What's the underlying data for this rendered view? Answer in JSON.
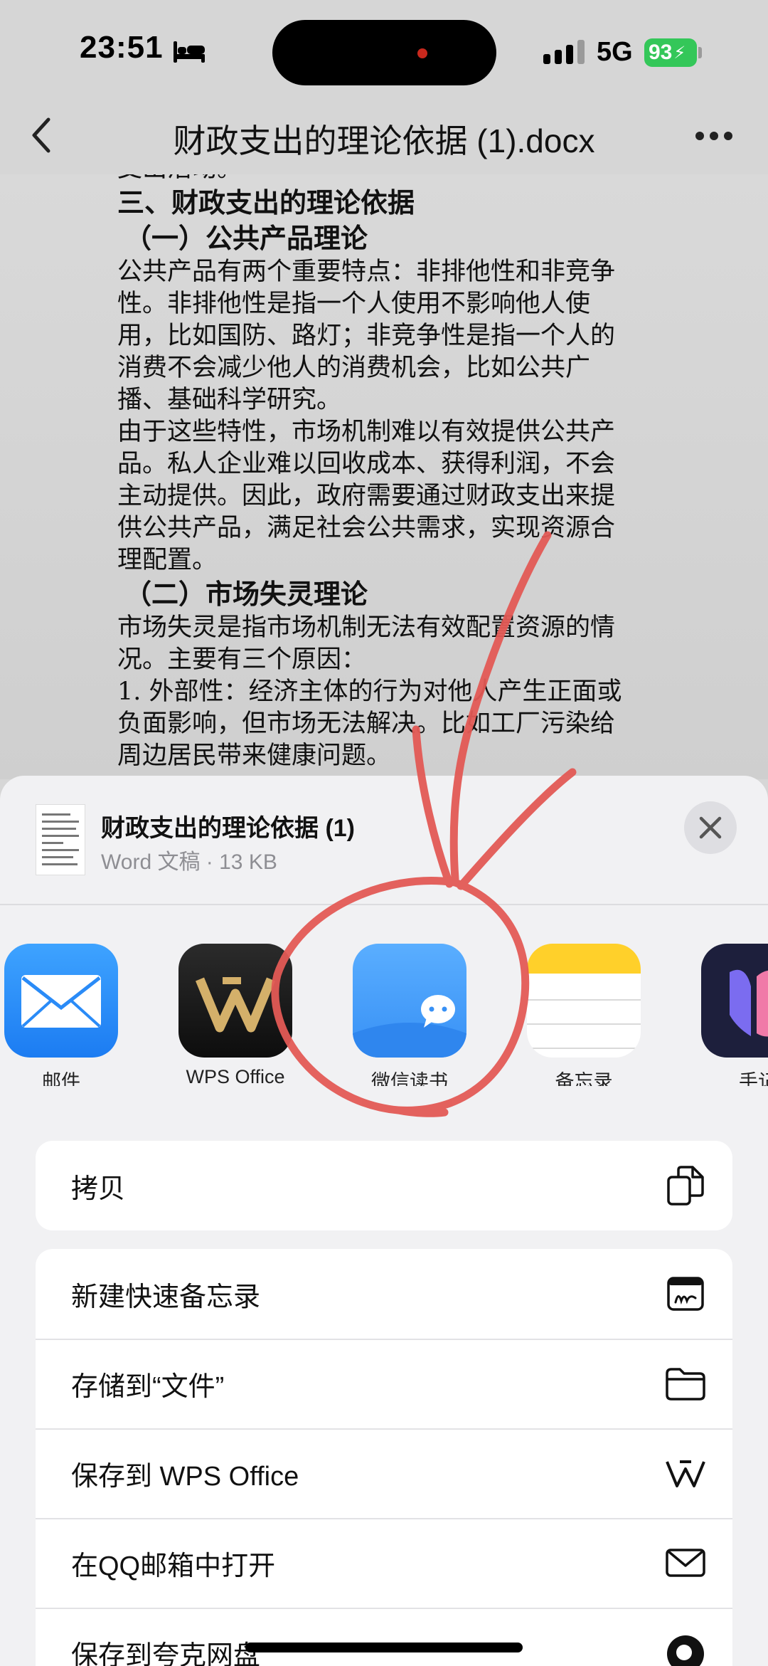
{
  "status_bar": {
    "time": "23:51",
    "network": "5G",
    "battery": "93",
    "icons": [
      "bed-icon",
      "signal-icon",
      "battery-charging-icon"
    ]
  },
  "nav": {
    "title": "财政支出的理论依据 (1).docx",
    "icons": [
      "chevron-left-icon",
      "more-icon"
    ]
  },
  "document": {
    "lines": [
      {
        "text": "支出活动。",
        "style": "body"
      },
      {
        "text": "三、财政支出的理论依据",
        "style": "heading"
      },
      {
        "text": "（一）公共产品理论",
        "style": "subheading"
      },
      {
        "text": "公共产品有两个重要特点：非排他性和非竞争性。非排他性是指一个人使用不影响他人使用，比如国防、路灯；非竞争性是指一个人的消费不会减少他人的消费机会，比如公共广播、基础科学研究。",
        "style": "body"
      },
      {
        "text": "由于这些特性，市场机制难以有效提供公共产品。私人企业难以回收成本、获得利润，不会主动提供。因此，政府需要通过财政支出来提供公共产品，满足社会公共需求，实现资源合理配置。",
        "style": "body"
      },
      {
        "text": "（二）市场失灵理论",
        "style": "subheading"
      },
      {
        "text": "市场失灵是指市场机制无法有效配置资源的情况。主要有三个原因：",
        "style": "body"
      },
      {
        "text": "1. 外部性：经济主体的行为对他人产生正面或负面影响，但市场无法解决。比如工厂污染给周边居民带来健康问题。",
        "style": "body"
      }
    ]
  },
  "share_sheet": {
    "file_name": "财政支出的理论依据 (1)",
    "file_meta": "Word 文稿 · 13 KB",
    "apps": [
      {
        "label": "邮件",
        "icon": "mail-icon"
      },
      {
        "label": "WPS Office",
        "icon": "wps-office-icon"
      },
      {
        "label": "微信读书",
        "icon": "weread-icon"
      },
      {
        "label": "备忘录",
        "icon": "notes-icon"
      },
      {
        "label": "手记",
        "icon": "handwrite-icon"
      }
    ],
    "actions_group1": [
      {
        "label": "拷贝",
        "icon": "copy-icon"
      }
    ],
    "actions_group2": [
      {
        "label": "新建快速备忘录",
        "icon": "quick-note-icon"
      },
      {
        "label": "存储到“文件”",
        "icon": "folder-icon"
      },
      {
        "label": "保存到 WPS Office",
        "icon": "wps-icon"
      },
      {
        "label": "在QQ邮箱中打开",
        "icon": "envelope-icon"
      },
      {
        "label": "保存到夸克网盘",
        "icon": "quark-icon"
      }
    ]
  },
  "annotation": {
    "color": "#e35a55",
    "shapes": [
      "arrow",
      "circle"
    ]
  }
}
